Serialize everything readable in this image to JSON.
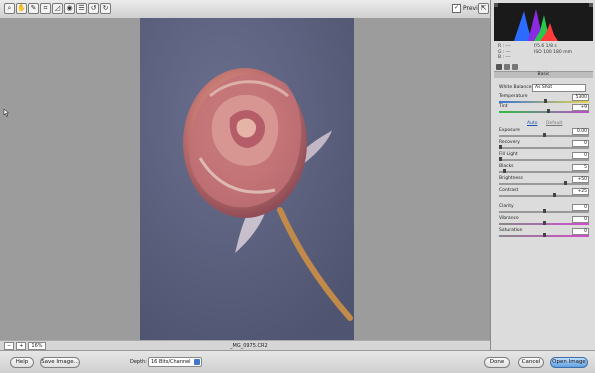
{
  "toolbar": {
    "tools": [
      "zoom-tool",
      "hand-tool",
      "white-balance-tool",
      "crop-tool",
      "straighten-tool",
      "redeye-tool",
      "preferences-tool",
      "rotate-left-tool",
      "rotate-right-tool"
    ],
    "preview_label": "Preview",
    "preview_checked": "✓"
  },
  "canvas": {
    "zoom_value": "16%",
    "filename": "_MG_0975.CR2"
  },
  "readout": {
    "r": "R :  ---",
    "g": "G :  ---",
    "b": "B :  ---",
    "exif_line1": "f/5.6   1/8 s",
    "exif_line2": "ISO 100   180 mm"
  },
  "panel": {
    "title": "Basic",
    "white_balance_label": "White Balance:",
    "white_balance_value": "As Shot",
    "auto_label": "Auto",
    "default_label": "Default",
    "sliders": [
      {
        "label": "Temperature",
        "value": "5300",
        "pos": 0.52
      },
      {
        "label": "Tint",
        "value": "+9",
        "pos": 0.55
      },
      {
        "label": "Exposure",
        "value": "0.00",
        "pos": 0.5
      },
      {
        "label": "Recovery",
        "value": "0",
        "pos": 0.0
      },
      {
        "label": "Fill Light",
        "value": "0",
        "pos": 0.0
      },
      {
        "label": "Blacks",
        "value": "5",
        "pos": 0.05
      },
      {
        "label": "Brightness",
        "value": "+50",
        "pos": 0.75
      },
      {
        "label": "Contrast",
        "value": "+25",
        "pos": 0.62
      },
      {
        "label": "Clarity",
        "value": "0",
        "pos": 0.5
      },
      {
        "label": "Vibrance",
        "value": "0",
        "pos": 0.5
      },
      {
        "label": "Saturation",
        "value": "0",
        "pos": 0.5
      }
    ]
  },
  "footer": {
    "help_label": "Help",
    "save_label": "Save Image...",
    "depth_label": "Depth:",
    "depth_value": "16 Bits/Channel",
    "done_label": "Done",
    "cancel_label": "Cancel",
    "open_label": "Open Image"
  },
  "colors": {
    "canvas_gray": "#9c9c9c",
    "photo_background": "#5f6483",
    "accent_blue": "#5f9fe0"
  }
}
